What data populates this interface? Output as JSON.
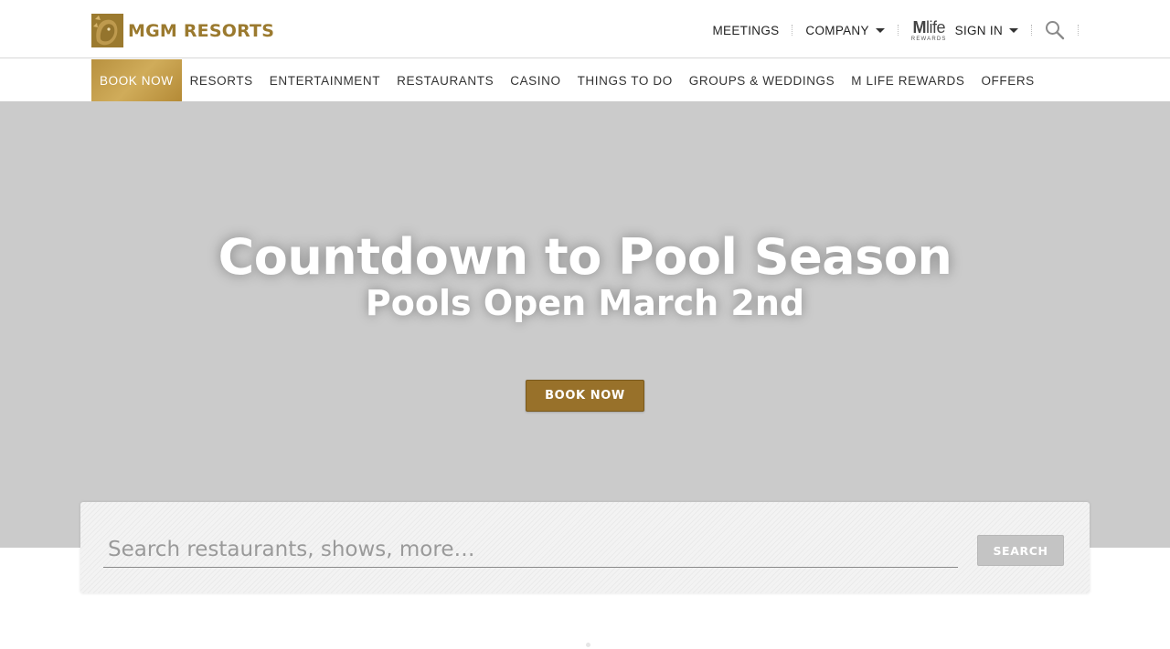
{
  "brand": {
    "name": "MGM RESORTS",
    "color": "#9b7a2f"
  },
  "utility_nav": {
    "meetings": "MEETINGS",
    "company": "COMPANY",
    "mlife_logo_main": "Mlife",
    "mlife_logo_sub": "REWARDS",
    "sign_in": "SIGN IN",
    "search_icon": "search-icon"
  },
  "main_nav": {
    "items": [
      {
        "label": "BOOK NOW"
      },
      {
        "label": "RESORTS"
      },
      {
        "label": "ENTERTAINMENT"
      },
      {
        "label": "RESTAURANTS"
      },
      {
        "label": "CASINO"
      },
      {
        "label": "THINGS TO DO"
      },
      {
        "label": "GROUPS & WEDDINGS"
      },
      {
        "label": "M LIFE REWARDS"
      },
      {
        "label": "OFFERS"
      }
    ],
    "active_index": 0,
    "active_color": "#c49c48"
  },
  "hero": {
    "title": "Countdown to Pool Season",
    "subtitle": "Pools Open March 2nd",
    "button_label": "BOOK NOW",
    "button_color": "#98712a"
  },
  "search": {
    "placeholder": "Search restaurants, shows, more…",
    "value": "",
    "button_label": "SEARCH"
  }
}
